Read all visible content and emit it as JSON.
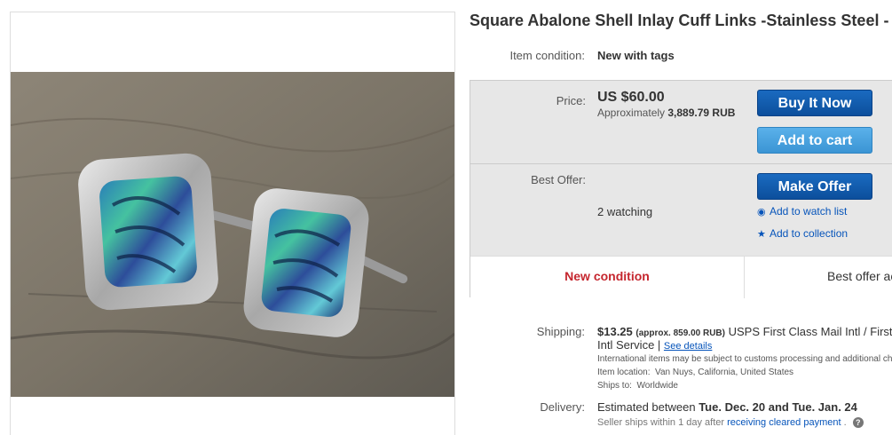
{
  "listing": {
    "title": "Square Abalone Shell Inlay Cuff Links -Stainless Steel - Handmade",
    "condition_label": "Item condition:",
    "condition_value": "New with tags"
  },
  "price": {
    "label": "Price:",
    "amount": "US $60.00",
    "approx_prefix": "Approximately",
    "approx_value": "3,889.79 RUB",
    "buy_now": "Buy It Now",
    "add_to_cart": "Add to cart"
  },
  "offer": {
    "label": "Best Offer:",
    "make_offer": "Make Offer",
    "watching": "2 watching",
    "watch_list": "Add to watch list",
    "collection": "Add to collection"
  },
  "bottom": {
    "new_condition": "New condition",
    "best_offer": "Best offer accepted"
  },
  "shipping": {
    "label": "Shipping:",
    "cost": "$13.25",
    "approx": "(approx. 859.00 RUB)",
    "service": "USPS First Class Mail Intl / First Class Package",
    "service_cont": "Intl Service",
    "see_details": "See details",
    "customs_note": "International items may be subject to customs processing and additional charges.",
    "location_label": "Item location:",
    "location": "Van Nuys, California, United States",
    "ships_to_label": "Ships to:",
    "ships_to": "Worldwide"
  },
  "delivery": {
    "label": "Delivery:",
    "estimated_prefix": "Estimated between",
    "dates": "Tue. Dec. 20 and Tue. Jan. 24",
    "seller_note": "Seller ships within 1 day after",
    "cleared_payment": "receiving cleared payment",
    "help": "?"
  },
  "colors": {
    "primary_button": "#0c4f9c",
    "secondary_button": "#3b95d4",
    "condition_red": "#c5262e",
    "link_blue": "#0654ba"
  },
  "icons": {
    "watch": "eye-icon",
    "collection": "star-icon",
    "help": "question-icon"
  }
}
